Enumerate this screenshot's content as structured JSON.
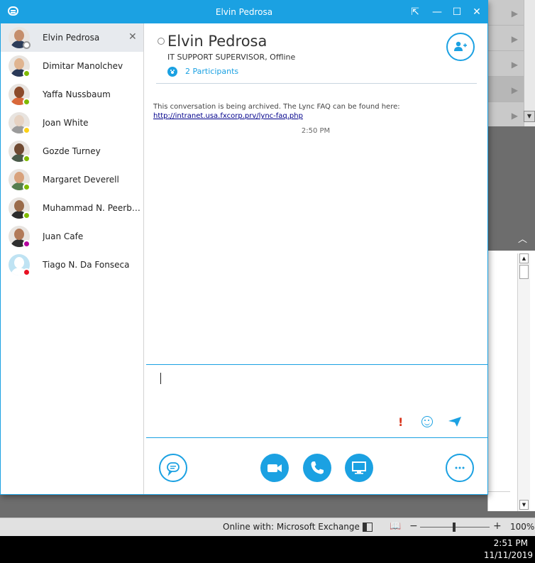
{
  "window": {
    "title": "Elvin Pedrosa",
    "controls": {
      "popout": "⇱",
      "minimize": "—",
      "maximize": "☐",
      "close": "✕"
    }
  },
  "contacts": [
    {
      "name": "Elvin Pedrosa",
      "presence": "offline",
      "active": true,
      "skin": "#c58e6b",
      "shirt": "#2d3d59"
    },
    {
      "name": "Dimitar Manolchev",
      "presence": "available",
      "active": false,
      "skin": "#e0b48f",
      "shirt": "#2a3957"
    },
    {
      "name": "Yaffa Nussbaum",
      "presence": "available",
      "active": false,
      "skin": "#8b4a2a",
      "shirt": "#d9683a"
    },
    {
      "name": "Joan White",
      "presence": "away",
      "active": false,
      "skin": "#e6d2c2",
      "shirt": "#9b9b9b"
    },
    {
      "name": "Gozde Turney",
      "presence": "available",
      "active": false,
      "skin": "#6f4a32",
      "shirt": "#4a5a4a"
    },
    {
      "name": "Margaret Deverell",
      "presence": "available",
      "active": false,
      "skin": "#d8a27c",
      "shirt": "#557d4e"
    },
    {
      "name": "Muhammad N. Peerbocus",
      "presence": "available",
      "active": false,
      "skin": "#9a6b4a",
      "shirt": "#2b2b2b"
    },
    {
      "name": "Juan Cafe",
      "presence": "oof",
      "active": false,
      "skin": "#b27a58",
      "shirt": "#2f2f2f"
    },
    {
      "name": "Tiago N. Da Fonseca",
      "presence": "busy",
      "active": false,
      "skin": "#bfe3f3",
      "shirt": "#bfe3f3"
    }
  ],
  "conversation": {
    "name": "Elvin Pedrosa",
    "subtitle": "IT SUPPORT SUPERVISOR,  Offline",
    "participants": "2 Participants",
    "archive_text": "This conversation is being archived. The Lync FAQ can be found here:",
    "archive_link": "http://intranet.usa.fxcorp.prv/lync-faq.php",
    "message_time": "2:50 PM"
  },
  "compose": {
    "important_glyph": "!"
  },
  "background_app": {
    "status_text": "Online with: Microsoft Exchange",
    "zoom": "100%",
    "minus": "−",
    "plus": "+",
    "flag": "▶",
    "chevron_up": "︿"
  },
  "taskbar": {
    "time": "2:51 PM",
    "date": "11/11/2019"
  },
  "colors": {
    "accent": "#1ba1e2",
    "available": "#7fba00",
    "away": "#fcd116",
    "busy": "#e81123",
    "important": "#d9361d"
  }
}
